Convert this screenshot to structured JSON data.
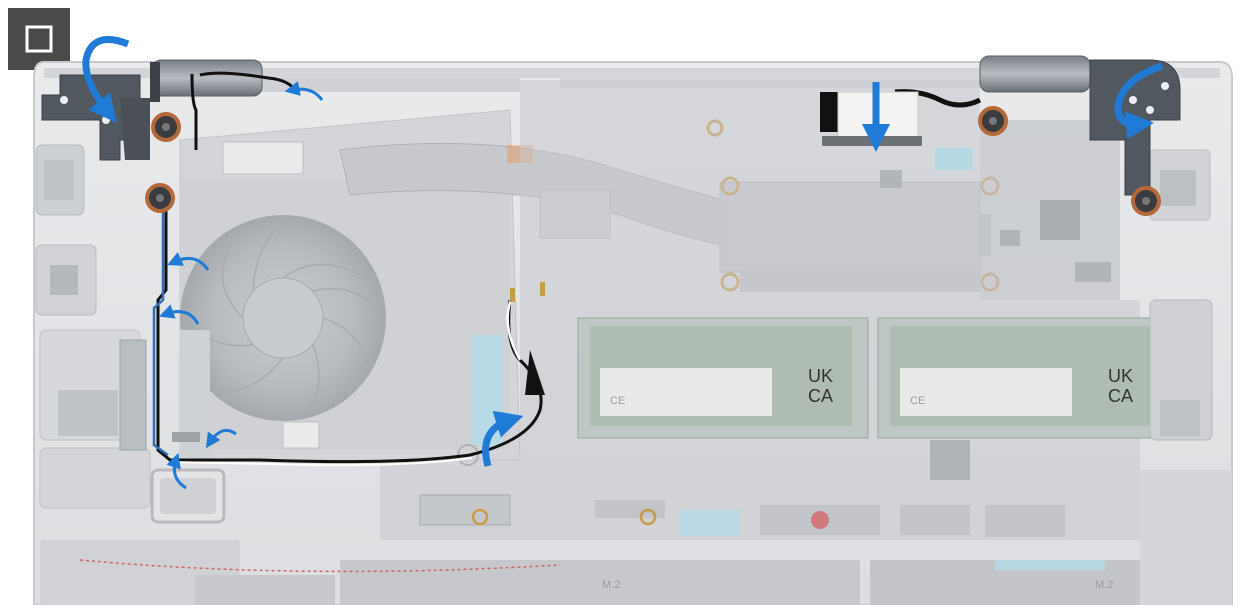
{
  "figure": {
    "step_icon": "square-icon",
    "marking_label_left": "UK",
    "marking_label_left_2": "CA",
    "marking_label_right": "UK",
    "marking_label_right_2": "CA",
    "ce_mark_left": "CE",
    "ce_mark_right": "CE",
    "ssd_label_left": "M.2",
    "ssd_label_right": "M.2"
  },
  "colors": {
    "callout_arrow": "#1f7bd6",
    "screw_highlight": "#b5683a",
    "antenna_black": "#111111",
    "antenna_white": "#ffffff",
    "antenna_blue": "#2f6fb7"
  }
}
